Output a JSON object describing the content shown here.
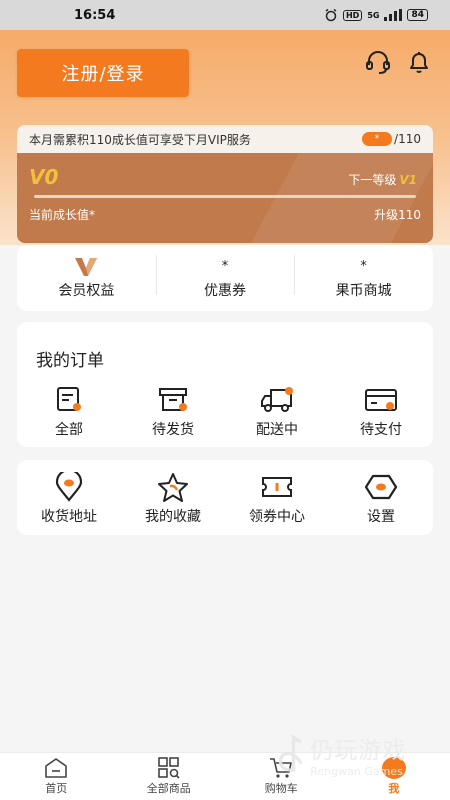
{
  "status_bar": {
    "time": "16:54",
    "battery": "84",
    "net_hd": "HD",
    "net_5g": "5G"
  },
  "header": {
    "login_label": "注册/登录",
    "service_icon": "headset-icon",
    "notification_icon": "bell-icon"
  },
  "vip": {
    "notice": "本月需累积110成长值可享受下月VIP服务",
    "progress_pill": "*",
    "goal": "/110",
    "current_level": "V0",
    "next_level_label": "下一等级",
    "next_level": "V1",
    "progress": 0,
    "current_growth_label": "当前成长值*",
    "upgrade_label": "升级110"
  },
  "benefits": [
    {
      "top": "V",
      "label": "会员权益"
    },
    {
      "top": "*",
      "label": "优惠券"
    },
    {
      "top": "*",
      "label": "果币商城"
    }
  ],
  "orders": {
    "title": "我的订单",
    "items": [
      {
        "label": "全部",
        "icon": "document-icon"
      },
      {
        "label": "待发货",
        "icon": "box-icon"
      },
      {
        "label": "配送中",
        "icon": "truck-icon"
      },
      {
        "label": "待支付",
        "icon": "card-icon"
      }
    ]
  },
  "services": [
    {
      "label": "收货地址",
      "icon": "location-pin-icon"
    },
    {
      "label": "我的收藏",
      "icon": "star-icon"
    },
    {
      "label": "领券中心",
      "icon": "ticket-icon"
    },
    {
      "label": "设置",
      "icon": "settings-hexagon-icon"
    }
  ],
  "tabbar": [
    {
      "label": "首页",
      "icon": "home-icon"
    },
    {
      "label": "全部商品",
      "icon": "grid-search-icon"
    },
    {
      "label": "购物车",
      "icon": "cart-icon"
    },
    {
      "label": "我",
      "icon": "profile-icon",
      "active": true
    }
  ],
  "watermark": {
    "cn": "仍玩游戏",
    "en": "Rengwan Games"
  },
  "colors": {
    "accent": "#f47a1f",
    "vip_card": "#c07a4c",
    "gold": "#f1c13a"
  }
}
